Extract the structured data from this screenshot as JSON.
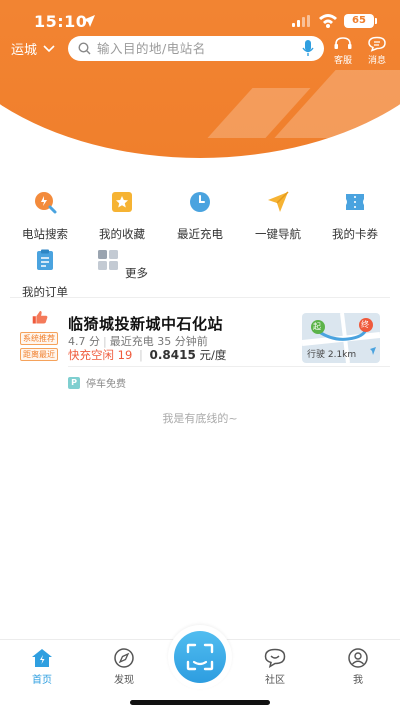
{
  "status_bar": {
    "time": "15:10",
    "battery": "65"
  },
  "header": {
    "city": "运城",
    "search_placeholder": "输入目的地/电站名",
    "service_label": "客服",
    "messages_label": "消息",
    "brand_color": "#f07f2c"
  },
  "quick_actions": [
    {
      "label": "电站搜索",
      "icon": "station-search-icon"
    },
    {
      "label": "我的收藏",
      "icon": "favorites-star-icon"
    },
    {
      "label": "最近充电",
      "icon": "clock-icon"
    },
    {
      "label": "一键导航",
      "icon": "navigation-arrow-icon"
    },
    {
      "label": "我的卡券",
      "icon": "coupon-ticket-icon"
    },
    {
      "label": "我的订单",
      "icon": "order-clipboard-icon"
    },
    {
      "label": "更多",
      "icon": "grid-more-icon"
    }
  ],
  "station": {
    "tags": [
      "系统推荐",
      "距离最近"
    ],
    "name": "临猗城投新城中石化站",
    "rating": "4.7 分",
    "recent_charge": "最近充电 35 分钟前",
    "fast_idle": "快充空闲 19",
    "price": "0.8415",
    "price_unit": "元/度",
    "map_start": "起",
    "map_end": "终",
    "distance": "行驶 2.1km",
    "parking": "停车免费",
    "parking_badge": "P"
  },
  "bottom_note": "我是有底线的~",
  "tabs": [
    {
      "label": "首页",
      "icon": "home-icon",
      "active": true
    },
    {
      "label": "发现",
      "icon": "compass-icon",
      "active": false
    },
    {
      "label": "社区",
      "icon": "chat-bubble-icon",
      "active": false
    },
    {
      "label": "我",
      "icon": "profile-icon",
      "active": false
    }
  ],
  "accent_color": "#2f9fe0"
}
